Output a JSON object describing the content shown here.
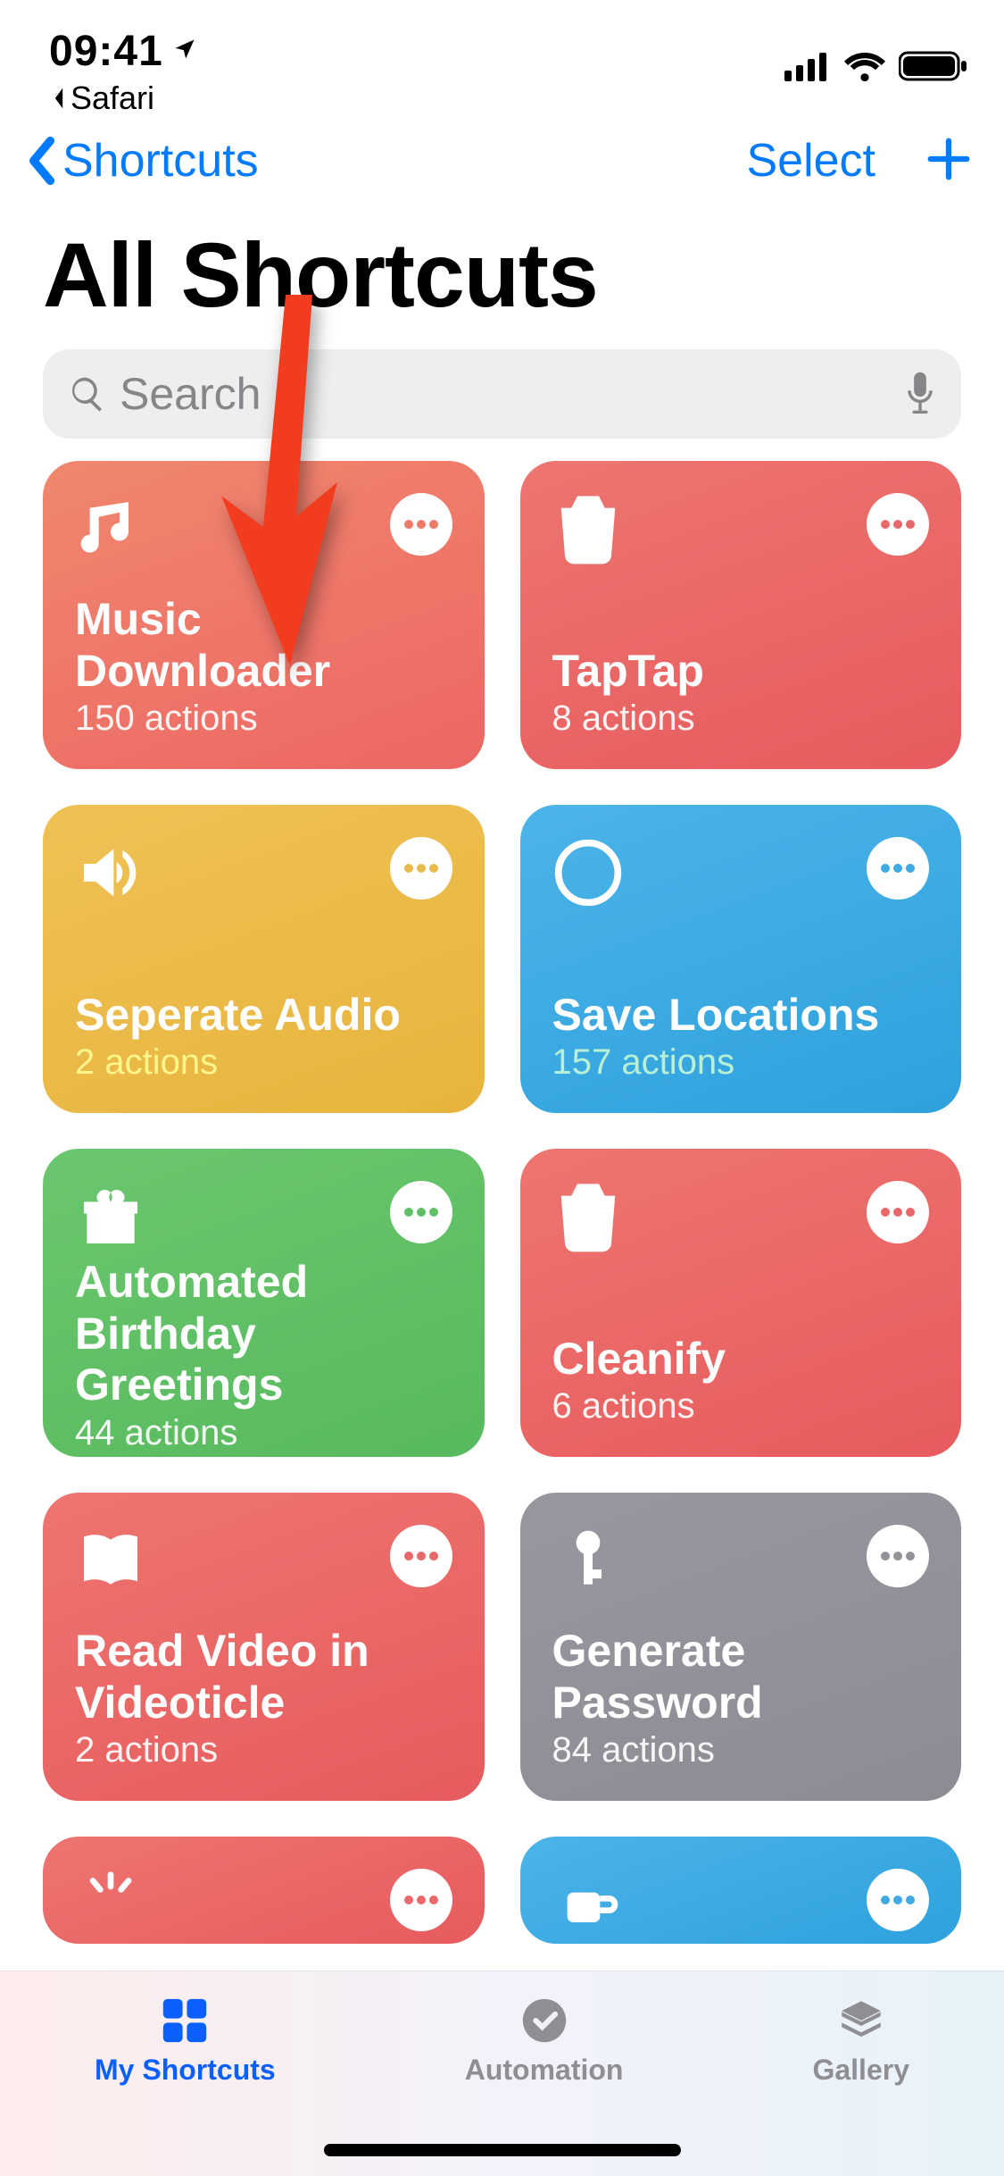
{
  "status": {
    "time": "09:41",
    "back_app": "Safari"
  },
  "nav": {
    "back_label": "Shortcuts",
    "select_label": "Select"
  },
  "page_title": "All Shortcuts",
  "search": {
    "placeholder": "Search"
  },
  "cards": [
    {
      "title": "Music Downloader",
      "actions": "150 actions",
      "icon": "music",
      "color": "orange"
    },
    {
      "title": "TapTap",
      "actions": "8 actions",
      "icon": "trash",
      "color": "red"
    },
    {
      "title": "Seperate Audio",
      "actions": "2 actions",
      "icon": "speaker",
      "color": "yellow"
    },
    {
      "title": "Save Locations",
      "actions": "157 actions",
      "icon": "safari",
      "color": "blue"
    },
    {
      "title": "Automated Birthday Greetings",
      "actions": "44 actions",
      "icon": "gift",
      "color": "green"
    },
    {
      "title": "Cleanify",
      "actions": "6 actions",
      "icon": "trash",
      "color": "red"
    },
    {
      "title": "Read Video in Videoticle",
      "actions": "2 actions",
      "icon": "book",
      "color": "red"
    },
    {
      "title": "Generate Password",
      "actions": "84 actions",
      "icon": "key",
      "color": "grey"
    }
  ],
  "tabs": {
    "my_shortcuts": "My Shortcuts",
    "automation": "Automation",
    "gallery": "Gallery"
  },
  "colors": {
    "tint": "#007aff"
  }
}
